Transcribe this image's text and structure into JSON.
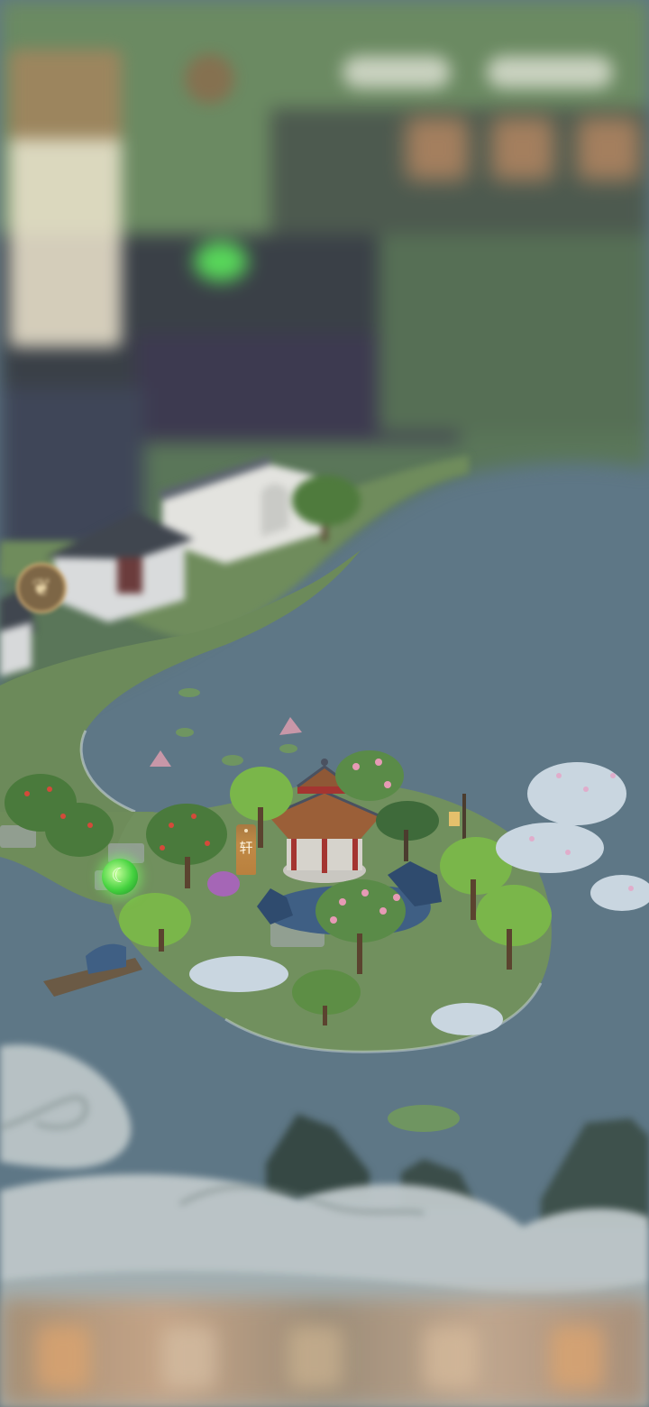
{
  "scene": {
    "pavilion_label": "轩",
    "orb_icon": "leaf-icon",
    "side_button_icon": "scroll-icon"
  },
  "colors": {
    "water": "#5d7685",
    "grass": "#6f8c5d",
    "orb": "#45d23f",
    "tag": "#b9803e"
  }
}
